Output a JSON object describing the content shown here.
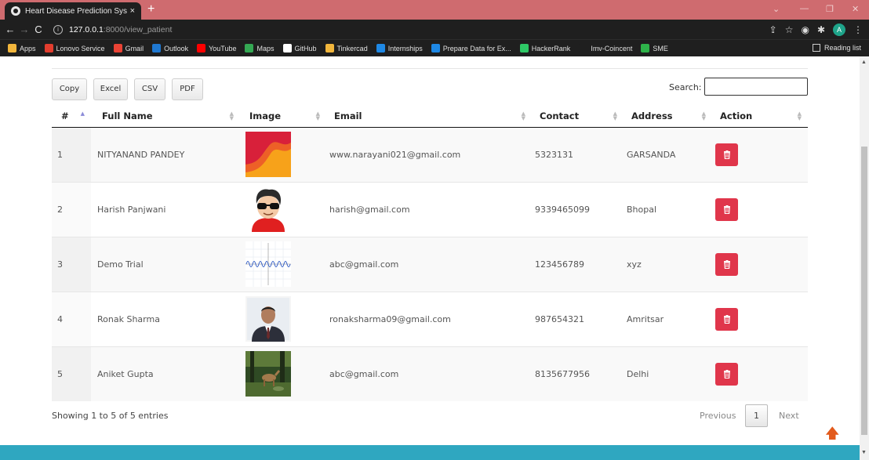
{
  "browser": {
    "tab_title": "Heart Disease Prediction System",
    "tab_close": "×",
    "new_tab": "+",
    "url_host": "127.0.0.1",
    "url_path": ":8000/view_patient",
    "profile_initial": "A",
    "bookmarks": [
      {
        "label": "Apps",
        "color": "#f2b63c"
      },
      {
        "label": "Lonovo Service",
        "color": "#e23d2e"
      },
      {
        "label": "Gmail",
        "color": "#ea4335"
      },
      {
        "label": "Outlook",
        "color": "#1f78d1"
      },
      {
        "label": "YouTube",
        "color": "#ff0000"
      },
      {
        "label": "Maps",
        "color": "#34a853"
      },
      {
        "label": "GitHub",
        "color": "#ffffff"
      },
      {
        "label": "Tinkercad",
        "color": "#f2b63c"
      },
      {
        "label": "Internships",
        "color": "#1e88e5"
      },
      {
        "label": "Prepare Data for Ex...",
        "color": "#1e88e5"
      },
      {
        "label": "HackerRank",
        "color": "#2ec866"
      },
      {
        "label": "Imv-Coincent",
        "color": "#1f1f1f"
      },
      {
        "label": "SME",
        "color": "#2eb34a"
      }
    ],
    "reading_list": "Reading list"
  },
  "toolbar": {
    "copy": "Copy",
    "excel": "Excel",
    "csv": "CSV",
    "pdf": "PDF",
    "search_label": "Search:"
  },
  "table": {
    "headers": [
      "#",
      "Full Name",
      "Image",
      "Email",
      "Contact",
      "Address",
      "Action"
    ],
    "rows": [
      {
        "idx": "1",
        "name": "NITYANAND PANDEY",
        "image": "orange-red-abstract",
        "email": "www.narayani021@gmail.com",
        "contact": "5323131",
        "address": "GARSANDA"
      },
      {
        "idx": "2",
        "name": "Harish Panjwani",
        "image": "cartoon-avatar-sunglasses",
        "email": "harish@gmail.com",
        "contact": "9339465099",
        "address": "Bhopal"
      },
      {
        "idx": "3",
        "name": "Demo Trial",
        "image": "sine-wave-graph",
        "email": "abc@gmail.com",
        "contact": "123456789",
        "address": "xyz"
      },
      {
        "idx": "4",
        "name": "Ronak Sharma",
        "image": "man-portrait-photo",
        "email": "ronaksharma09@gmail.com",
        "contact": "987654321",
        "address": "Amritsar"
      },
      {
        "idx": "5",
        "name": "Aniket Gupta",
        "image": "deer-in-forest-photo",
        "email": "abc@gmail.com",
        "contact": "8135677956",
        "address": "Delhi"
      }
    ],
    "action_icon": "trash-icon"
  },
  "pagination": {
    "info": "Showing 1 to 5 of 5 entries",
    "previous": "Previous",
    "page": "1",
    "next": "Next"
  },
  "colors": {
    "delete_button": "#e0364b",
    "footer": "#2fa7c0",
    "tab_strip": "#cf6b6f"
  }
}
